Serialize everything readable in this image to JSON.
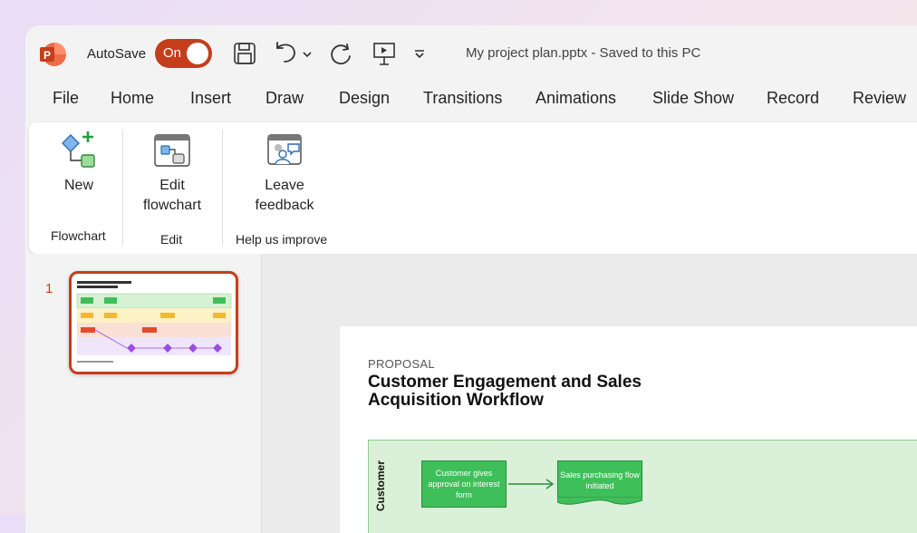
{
  "titlebar": {
    "autosave_label": "AutoSave",
    "autosave_state": "On",
    "document_title": "My project plan.pptx - Saved to this PC",
    "accent_color": "#c43e1c"
  },
  "tabs": [
    "File",
    "Home",
    "Insert",
    "Draw",
    "Design",
    "Transitions",
    "Animations",
    "Slide Show",
    "Record",
    "Review"
  ],
  "ribbon": {
    "new_label": "New",
    "edit_label_1": "Edit",
    "edit_label_2": "flowchart",
    "feedback_label_1": "Leave",
    "feedback_label_2": "feedback",
    "group_flowchart": "Flowchart",
    "group_edit": "Edit",
    "group_help": "Help us improve"
  },
  "thumbnails": {
    "slide_number": "1"
  },
  "slide": {
    "eyebrow": "PROPOSAL",
    "title": "Customer Engagement and Sales Acquisition Workflow",
    "lane_label": "Customer",
    "box1": "Customer gives approval on interest form",
    "box2": "Sales purchasing flow initiated"
  }
}
